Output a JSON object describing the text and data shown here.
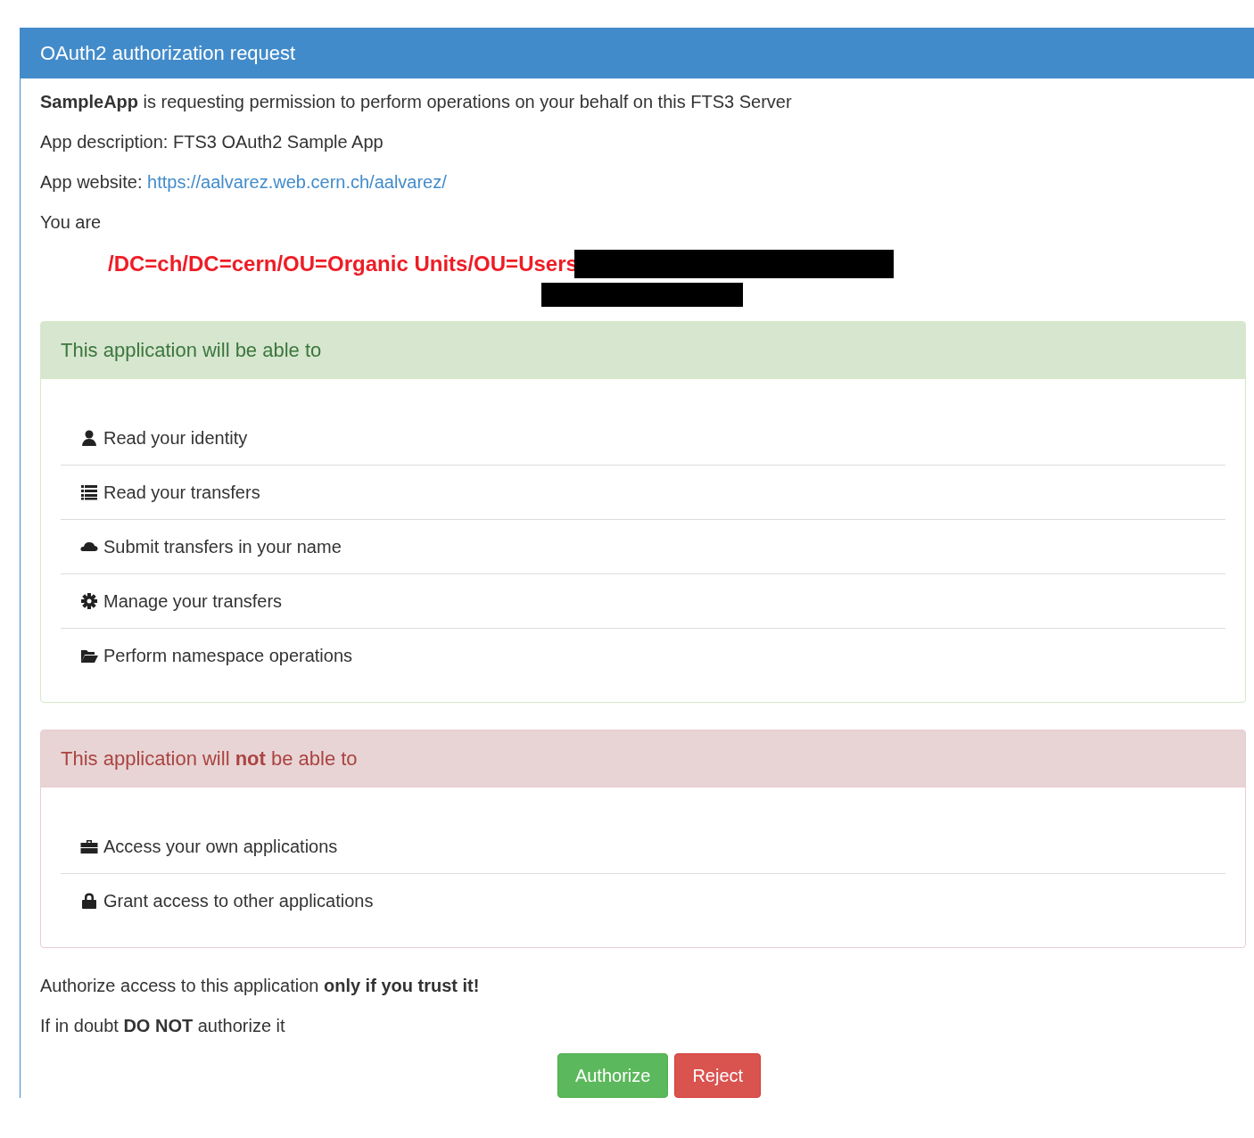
{
  "panel": {
    "title": "OAuth2 authorization request"
  },
  "intro": "**SampleApp** is requesting permission to perform operations on your behalf on this FTS3 Server",
  "description": "App description: FTS3 OAuth2 Sample App",
  "website": {
    "label": "App website:",
    "url": "https://aalvarez.web.cern.ch/aalvarez/"
  },
  "you_are": "You are",
  "identity": "/DC=ch/DC=cern/OU=Organic Units/OU=Users",
  "sections": [
    {
      "kind": "allowed",
      "title": "This application will be able to",
      "items": [
        {
          "kind": "user",
          "label": "Read your identity"
        },
        {
          "kind": "list",
          "label": "Read your transfers"
        },
        {
          "kind": "cloud",
          "label": "Submit transfers in your name"
        },
        {
          "kind": "cog",
          "label": "Manage your transfers"
        },
        {
          "kind": "folder",
          "label": "Perform namespace operations"
        }
      ]
    },
    {
      "kind": "denied",
      "title": "This application will **not** be able to",
      "items": [
        {
          "kind": "briefcase",
          "label": "Access your own applications"
        },
        {
          "kind": "lock",
          "label": "Grant access to other applications"
        }
      ]
    }
  ],
  "warnings": [
    "Authorize access to this application **only if you trust it!**",
    "If in doubt **DO NOT** authorize it"
  ],
  "buttons": [
    {
      "kind": "success",
      "label": "Authorize"
    },
    {
      "kind": "danger",
      "label": "Reject"
    }
  ]
}
